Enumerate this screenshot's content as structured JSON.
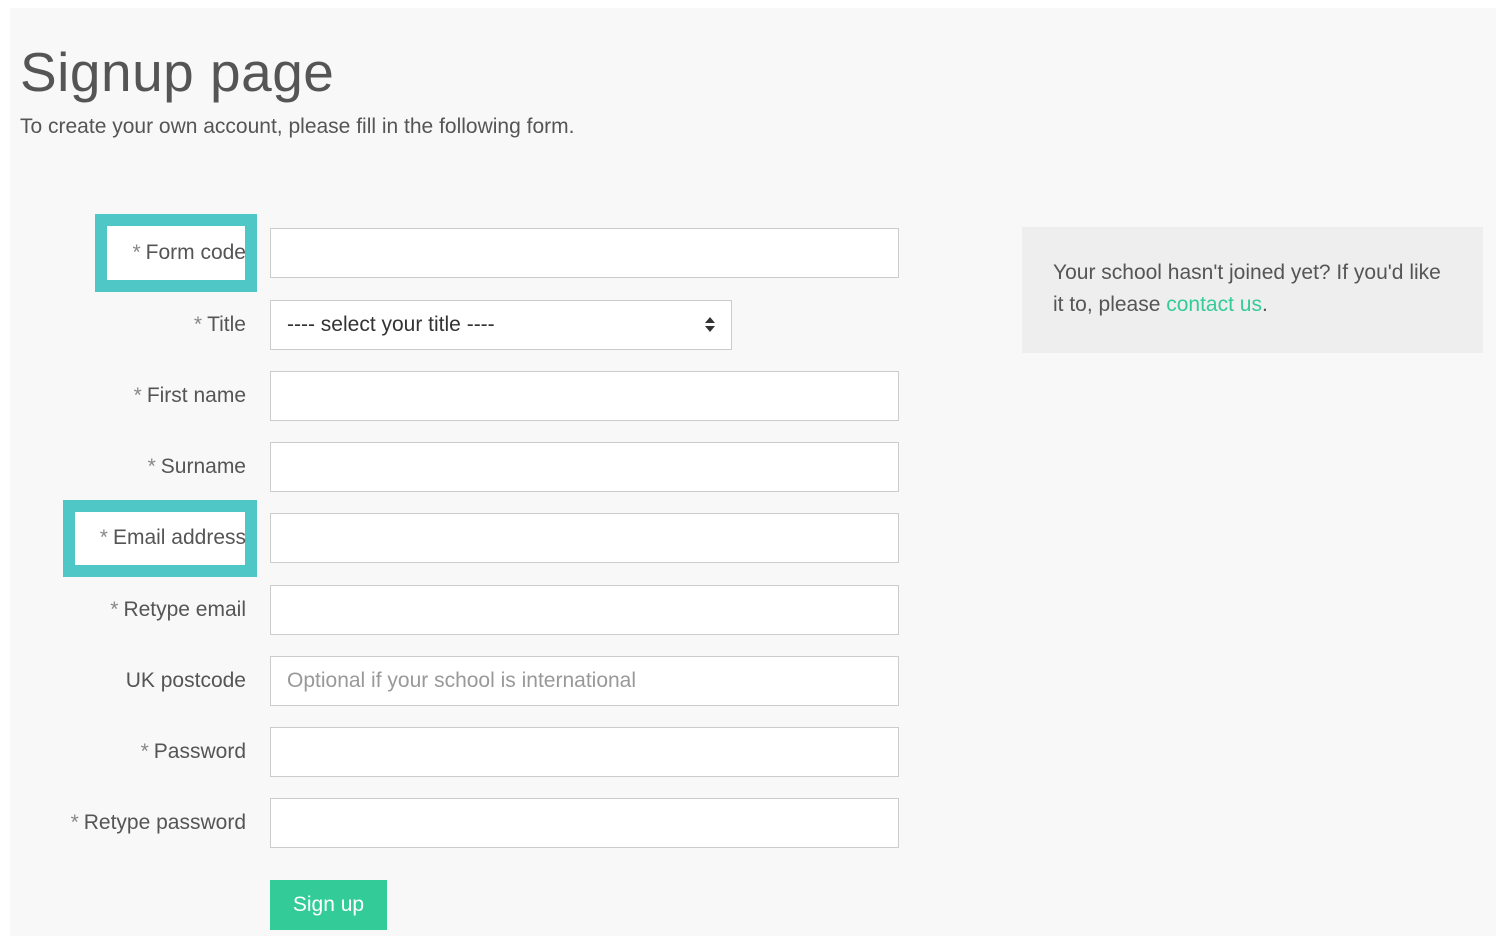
{
  "header": {
    "title": "Signup page",
    "subtitle": "To create your own account, please fill in the following form."
  },
  "form": {
    "required_marker": "*",
    "fields": {
      "form_code": {
        "label": "Form code",
        "value": "",
        "placeholder": ""
      },
      "title": {
        "label": "Title",
        "selected": "---- select your title ----"
      },
      "first_name": {
        "label": "First name",
        "value": "",
        "placeholder": ""
      },
      "surname": {
        "label": "Surname",
        "value": "",
        "placeholder": ""
      },
      "email": {
        "label": "Email address",
        "value": "",
        "placeholder": ""
      },
      "retype_email": {
        "label": "Retype email",
        "value": "",
        "placeholder": ""
      },
      "postcode": {
        "label": "UK postcode",
        "value": "",
        "placeholder": "Optional if your school is international"
      },
      "password": {
        "label": "Password",
        "value": "",
        "placeholder": ""
      },
      "retype_password": {
        "label": "Retype password",
        "value": "",
        "placeholder": ""
      }
    },
    "submit_label": "Sign up"
  },
  "info_box": {
    "text": "Your school hasn't joined yet? If you'd like it to, please ",
    "link_text": "contact us",
    "suffix": "."
  },
  "colors": {
    "accent": "#33cc99",
    "highlight": "#4fc7c6"
  }
}
